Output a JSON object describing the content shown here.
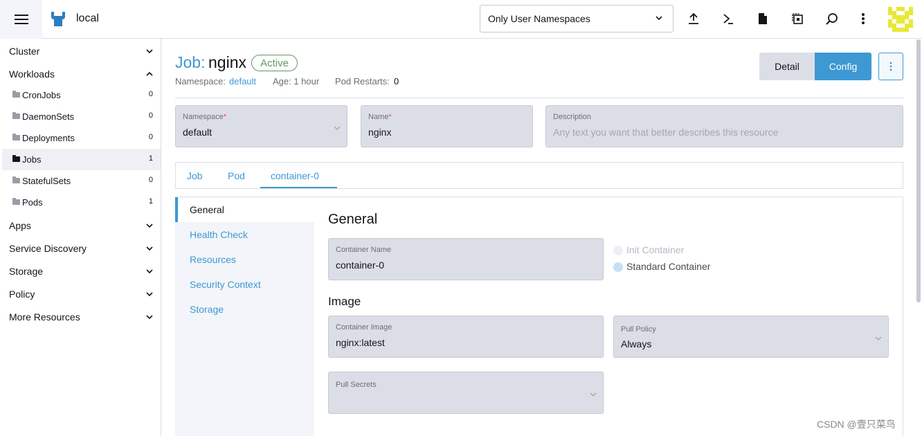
{
  "header": {
    "cluster_name": "local",
    "namespace_filter": "Only User Namespaces",
    "icons": [
      "menu-icon",
      "upload-icon",
      "terminal-icon",
      "file-icon",
      "copy-config-icon",
      "search-icon",
      "more-vertical-icon"
    ]
  },
  "sidebar": {
    "groups": [
      {
        "label": "Cluster",
        "expanded": false
      },
      {
        "label": "Workloads",
        "expanded": true
      },
      {
        "label": "Apps",
        "expanded": false
      },
      {
        "label": "Service Discovery",
        "expanded": false
      },
      {
        "label": "Storage",
        "expanded": false
      },
      {
        "label": "Policy",
        "expanded": false
      },
      {
        "label": "More Resources",
        "expanded": false
      }
    ],
    "workloads": [
      {
        "label": "CronJobs",
        "count": "0"
      },
      {
        "label": "DaemonSets",
        "count": "0"
      },
      {
        "label": "Deployments",
        "count": "0"
      },
      {
        "label": "Jobs",
        "count": "1",
        "active": true
      },
      {
        "label": "StatefulSets",
        "count": "0"
      },
      {
        "label": "Pods",
        "count": "1"
      }
    ]
  },
  "page": {
    "title_prefix": "Job:",
    "title_name": "nginx",
    "status": "Active",
    "namespace_label": "Namespace:",
    "namespace_value": "default",
    "age": "Age: 1 hour",
    "restarts_label": "Pod Restarts:",
    "restarts_value": "0",
    "btn_detail": "Detail",
    "btn_config": "Config"
  },
  "form": {
    "namespace": {
      "label": "Namespace",
      "required": "*",
      "value": "default"
    },
    "name": {
      "label": "Name",
      "required": "*",
      "value": "nginx"
    },
    "description": {
      "label": "Description",
      "placeholder": "Any text you want that better describes this resource"
    }
  },
  "tabs": [
    "Job",
    "Pod",
    "container-0"
  ],
  "side_tabs": [
    "General",
    "Health Check",
    "Resources",
    "Security Context",
    "Storage"
  ],
  "general": {
    "heading": "General",
    "container_name_label": "Container Name",
    "container_name_value": "container-0",
    "init_container": "Init Container",
    "standard_container": "Standard Container",
    "image_heading": "Image",
    "container_image_label": "Container Image",
    "container_image_value": "nginx:latest",
    "pull_policy_label": "Pull Policy",
    "pull_policy_value": "Always",
    "pull_secrets_label": "Pull Secrets"
  },
  "watermark": "CSDN @壹只菜鸟",
  "colors": {
    "accent": "#3d98d3",
    "active_badge": "#5d995d",
    "required": "#f64747"
  }
}
